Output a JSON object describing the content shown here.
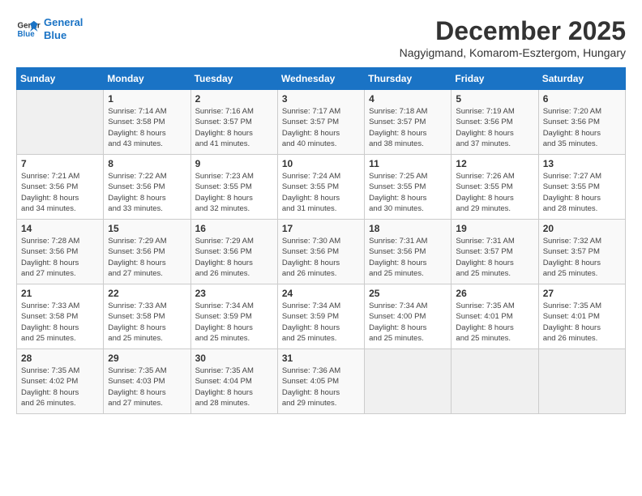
{
  "header": {
    "logo_line1": "General",
    "logo_line2": "Blue",
    "month_year": "December 2025",
    "location": "Nagyigmand, Komarom-Esztergom, Hungary"
  },
  "weekdays": [
    "Sunday",
    "Monday",
    "Tuesday",
    "Wednesday",
    "Thursday",
    "Friday",
    "Saturday"
  ],
  "weeks": [
    [
      {
        "day": "",
        "info": ""
      },
      {
        "day": "1",
        "info": "Sunrise: 7:14 AM\nSunset: 3:58 PM\nDaylight: 8 hours\nand 43 minutes."
      },
      {
        "day": "2",
        "info": "Sunrise: 7:16 AM\nSunset: 3:57 PM\nDaylight: 8 hours\nand 41 minutes."
      },
      {
        "day": "3",
        "info": "Sunrise: 7:17 AM\nSunset: 3:57 PM\nDaylight: 8 hours\nand 40 minutes."
      },
      {
        "day": "4",
        "info": "Sunrise: 7:18 AM\nSunset: 3:57 PM\nDaylight: 8 hours\nand 38 minutes."
      },
      {
        "day": "5",
        "info": "Sunrise: 7:19 AM\nSunset: 3:56 PM\nDaylight: 8 hours\nand 37 minutes."
      },
      {
        "day": "6",
        "info": "Sunrise: 7:20 AM\nSunset: 3:56 PM\nDaylight: 8 hours\nand 35 minutes."
      }
    ],
    [
      {
        "day": "7",
        "info": "Sunrise: 7:21 AM\nSunset: 3:56 PM\nDaylight: 8 hours\nand 34 minutes."
      },
      {
        "day": "8",
        "info": "Sunrise: 7:22 AM\nSunset: 3:56 PM\nDaylight: 8 hours\nand 33 minutes."
      },
      {
        "day": "9",
        "info": "Sunrise: 7:23 AM\nSunset: 3:55 PM\nDaylight: 8 hours\nand 32 minutes."
      },
      {
        "day": "10",
        "info": "Sunrise: 7:24 AM\nSunset: 3:55 PM\nDaylight: 8 hours\nand 31 minutes."
      },
      {
        "day": "11",
        "info": "Sunrise: 7:25 AM\nSunset: 3:55 PM\nDaylight: 8 hours\nand 30 minutes."
      },
      {
        "day": "12",
        "info": "Sunrise: 7:26 AM\nSunset: 3:55 PM\nDaylight: 8 hours\nand 29 minutes."
      },
      {
        "day": "13",
        "info": "Sunrise: 7:27 AM\nSunset: 3:55 PM\nDaylight: 8 hours\nand 28 minutes."
      }
    ],
    [
      {
        "day": "14",
        "info": "Sunrise: 7:28 AM\nSunset: 3:56 PM\nDaylight: 8 hours\nand 27 minutes."
      },
      {
        "day": "15",
        "info": "Sunrise: 7:29 AM\nSunset: 3:56 PM\nDaylight: 8 hours\nand 27 minutes."
      },
      {
        "day": "16",
        "info": "Sunrise: 7:29 AM\nSunset: 3:56 PM\nDaylight: 8 hours\nand 26 minutes."
      },
      {
        "day": "17",
        "info": "Sunrise: 7:30 AM\nSunset: 3:56 PM\nDaylight: 8 hours\nand 26 minutes."
      },
      {
        "day": "18",
        "info": "Sunrise: 7:31 AM\nSunset: 3:56 PM\nDaylight: 8 hours\nand 25 minutes."
      },
      {
        "day": "19",
        "info": "Sunrise: 7:31 AM\nSunset: 3:57 PM\nDaylight: 8 hours\nand 25 minutes."
      },
      {
        "day": "20",
        "info": "Sunrise: 7:32 AM\nSunset: 3:57 PM\nDaylight: 8 hours\nand 25 minutes."
      }
    ],
    [
      {
        "day": "21",
        "info": "Sunrise: 7:33 AM\nSunset: 3:58 PM\nDaylight: 8 hours\nand 25 minutes."
      },
      {
        "day": "22",
        "info": "Sunrise: 7:33 AM\nSunset: 3:58 PM\nDaylight: 8 hours\nand 25 minutes."
      },
      {
        "day": "23",
        "info": "Sunrise: 7:34 AM\nSunset: 3:59 PM\nDaylight: 8 hours\nand 25 minutes."
      },
      {
        "day": "24",
        "info": "Sunrise: 7:34 AM\nSunset: 3:59 PM\nDaylight: 8 hours\nand 25 minutes."
      },
      {
        "day": "25",
        "info": "Sunrise: 7:34 AM\nSunset: 4:00 PM\nDaylight: 8 hours\nand 25 minutes."
      },
      {
        "day": "26",
        "info": "Sunrise: 7:35 AM\nSunset: 4:01 PM\nDaylight: 8 hours\nand 25 minutes."
      },
      {
        "day": "27",
        "info": "Sunrise: 7:35 AM\nSunset: 4:01 PM\nDaylight: 8 hours\nand 26 minutes."
      }
    ],
    [
      {
        "day": "28",
        "info": "Sunrise: 7:35 AM\nSunset: 4:02 PM\nDaylight: 8 hours\nand 26 minutes."
      },
      {
        "day": "29",
        "info": "Sunrise: 7:35 AM\nSunset: 4:03 PM\nDaylight: 8 hours\nand 27 minutes."
      },
      {
        "day": "30",
        "info": "Sunrise: 7:35 AM\nSunset: 4:04 PM\nDaylight: 8 hours\nand 28 minutes."
      },
      {
        "day": "31",
        "info": "Sunrise: 7:36 AM\nSunset: 4:05 PM\nDaylight: 8 hours\nand 29 minutes."
      },
      {
        "day": "",
        "info": ""
      },
      {
        "day": "",
        "info": ""
      },
      {
        "day": "",
        "info": ""
      }
    ]
  ]
}
